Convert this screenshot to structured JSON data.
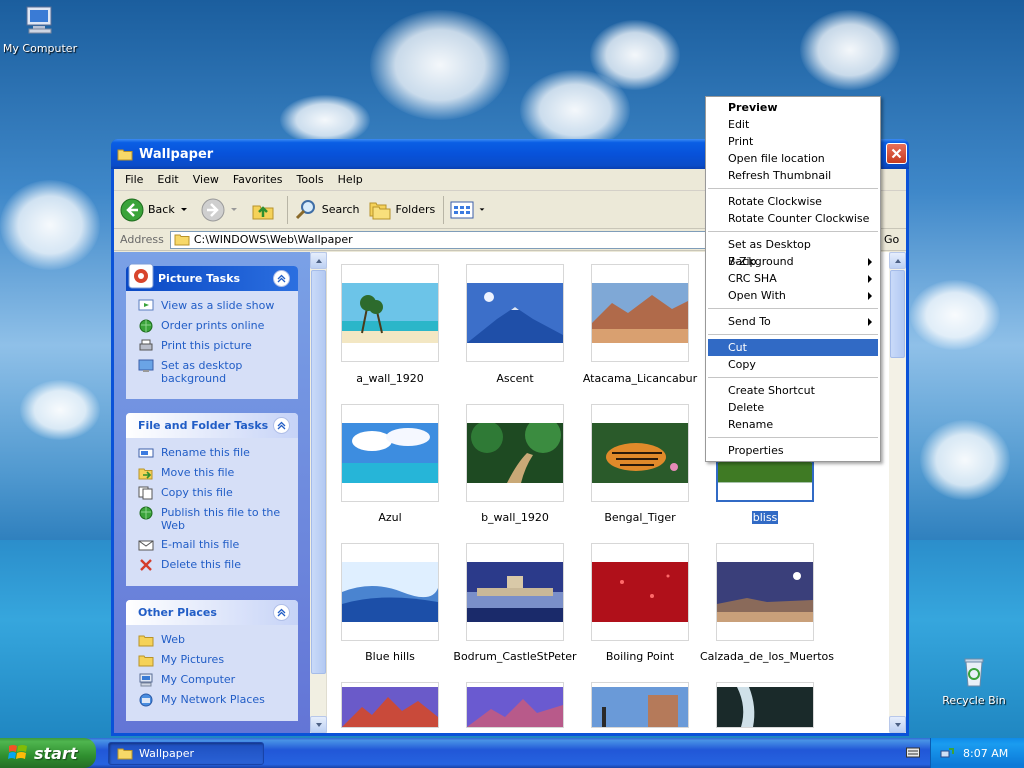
{
  "desktop": {
    "icons": [
      {
        "label": "My Computer"
      },
      {
        "label": "Recycle Bin"
      }
    ]
  },
  "window": {
    "title": "Wallpaper",
    "menu": [
      "File",
      "Edit",
      "View",
      "Favorites",
      "Tools",
      "Help"
    ],
    "toolbar": {
      "back": "Back",
      "search": "Search",
      "folders": "Folders"
    },
    "address": {
      "label": "Address",
      "value": "C:\\WINDOWS\\Web\\Wallpaper",
      "go": "Go"
    }
  },
  "taskpane": {
    "picture_tasks": {
      "title": "Picture Tasks",
      "items": [
        "View as a slide show",
        "Order prints online",
        "Print this picture",
        "Set as desktop background"
      ]
    },
    "file_tasks": {
      "title": "File and Folder Tasks",
      "items": [
        "Rename this file",
        "Move this file",
        "Copy this file",
        "Publish this file to the Web",
        "E-mail this file",
        "Delete this file"
      ]
    },
    "other_places": {
      "title": "Other Places",
      "items": [
        "Web",
        "My Pictures",
        "My Computer",
        "My Network Places"
      ]
    }
  },
  "files": [
    {
      "name": "a_wall_1920"
    },
    {
      "name": "Ascent"
    },
    {
      "name": "Atacama_Licancabur"
    },
    {
      "name": "Azul"
    },
    {
      "name": "b_wall_1920"
    },
    {
      "name": "Bengal_Tiger"
    },
    {
      "name": "bliss"
    },
    {
      "name": "Blue hills"
    },
    {
      "name": "Bodrum_CastleStPeter"
    },
    {
      "name": "Boiling Point"
    },
    {
      "name": "Calzada_de_los_Muertos"
    }
  ],
  "context_menu": {
    "items": [
      "Preview",
      "Edit",
      "Print",
      "Open file location",
      "Refresh Thumbnail",
      "Rotate Clockwise",
      "Rotate Counter Clockwise",
      "Set as Desktop Background",
      "7-Zip",
      "CRC SHA",
      "Open With",
      "Send To",
      "Cut",
      "Copy",
      "Create Shortcut",
      "Delete",
      "Rename",
      "Properties"
    ]
  },
  "taskbar": {
    "start": "start",
    "task": "Wallpaper",
    "clock": "8:07 AM"
  }
}
